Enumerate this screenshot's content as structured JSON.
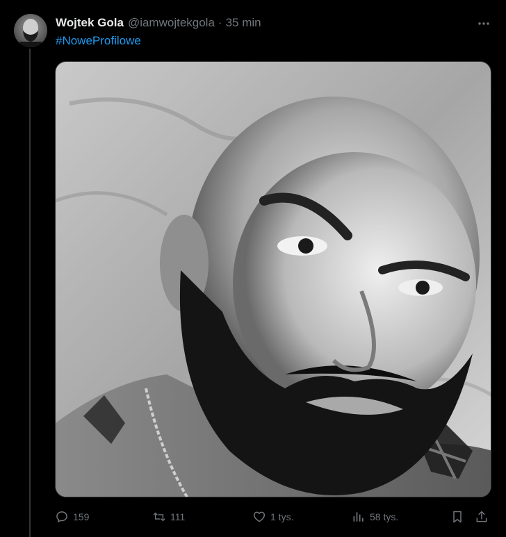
{
  "tweet": {
    "author": {
      "display_name": "Wojtek Gola",
      "handle": "@iamwojtekgola",
      "separator": "·",
      "time": "35 min",
      "avatar_icon": "avatar-photo"
    },
    "text": "#NoweProfilowe",
    "media": {
      "kind": "black-and-white selfie photo",
      "palette": "grayscale"
    },
    "actions": {
      "replies": "159",
      "retweets": "111",
      "likes": "1 tys.",
      "views": "58 tys."
    }
  },
  "colors": {
    "background": "#000000",
    "text_primary": "#e7e9ea",
    "text_secondary": "#71767b",
    "link": "#1d9bf0",
    "border": "#2f3336"
  }
}
